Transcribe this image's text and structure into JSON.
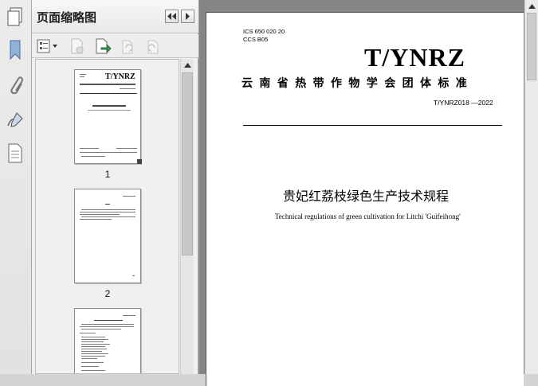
{
  "panel": {
    "title": "页面缩略图"
  },
  "thumbnails": [
    {
      "label": "1",
      "mini_logo": "T/YNRZ"
    },
    {
      "label": "2"
    },
    {
      "label": ""
    }
  ],
  "document": {
    "ics": "ICS  650  020  20",
    "ccs": "CCS  B05",
    "logo": "T/YNRZ",
    "org_name": "云南省热带作物学会团体标准",
    "std_number": "T/YNRZ018  —2022",
    "title_cn": "贵妃红荔枝绿色生产技术规程",
    "title_en": "Technical regulations of green cultivation for Litchi 'Guifeihong'"
  }
}
